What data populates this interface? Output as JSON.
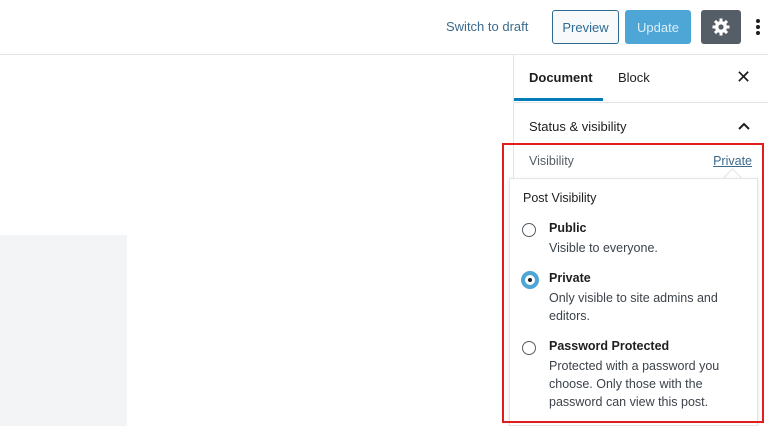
{
  "topbar": {
    "switch_to_draft": "Switch to draft",
    "preview": "Preview",
    "update": "Update",
    "settings_icon": "gear-icon",
    "more_icon": "vertical-ellipsis-icon"
  },
  "sidebar": {
    "tabs": [
      {
        "label": "Document",
        "active": true
      },
      {
        "label": "Block",
        "active": false
      }
    ],
    "close_icon": "close-icon",
    "panel_title": "Status & visibility",
    "visibility_label": "Visibility",
    "visibility_value": "Private"
  },
  "popover": {
    "title": "Post Visibility",
    "options": [
      {
        "label": "Public",
        "description": "Visible to everyone.",
        "checked": false
      },
      {
        "label": "Private",
        "description": "Only visible to site admins and editors.",
        "checked": true
      },
      {
        "label": "Password Protected",
        "description": "Protected with a password you choose. Only those with the password can view this post.",
        "checked": false
      }
    ]
  },
  "colors": {
    "accent": "#007cba",
    "update_button": "#4ea6d6",
    "highlight": "#e11d1d"
  }
}
